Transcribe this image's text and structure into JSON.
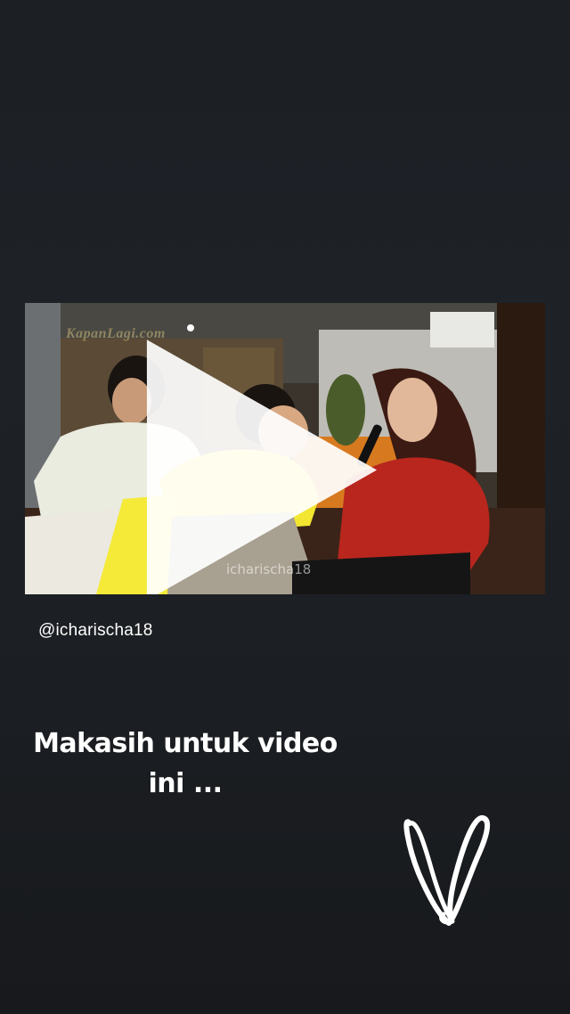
{
  "story": {
    "video": {
      "logo_text": "KapanLagi.com",
      "watermark": "icharischa18",
      "play_icon": "play-icon"
    },
    "mention": "@icharischa18",
    "caption_line1": "Makasih untuk video",
    "caption_line2": "ini ...",
    "doodle_icon": "heart-scribble-icon"
  }
}
